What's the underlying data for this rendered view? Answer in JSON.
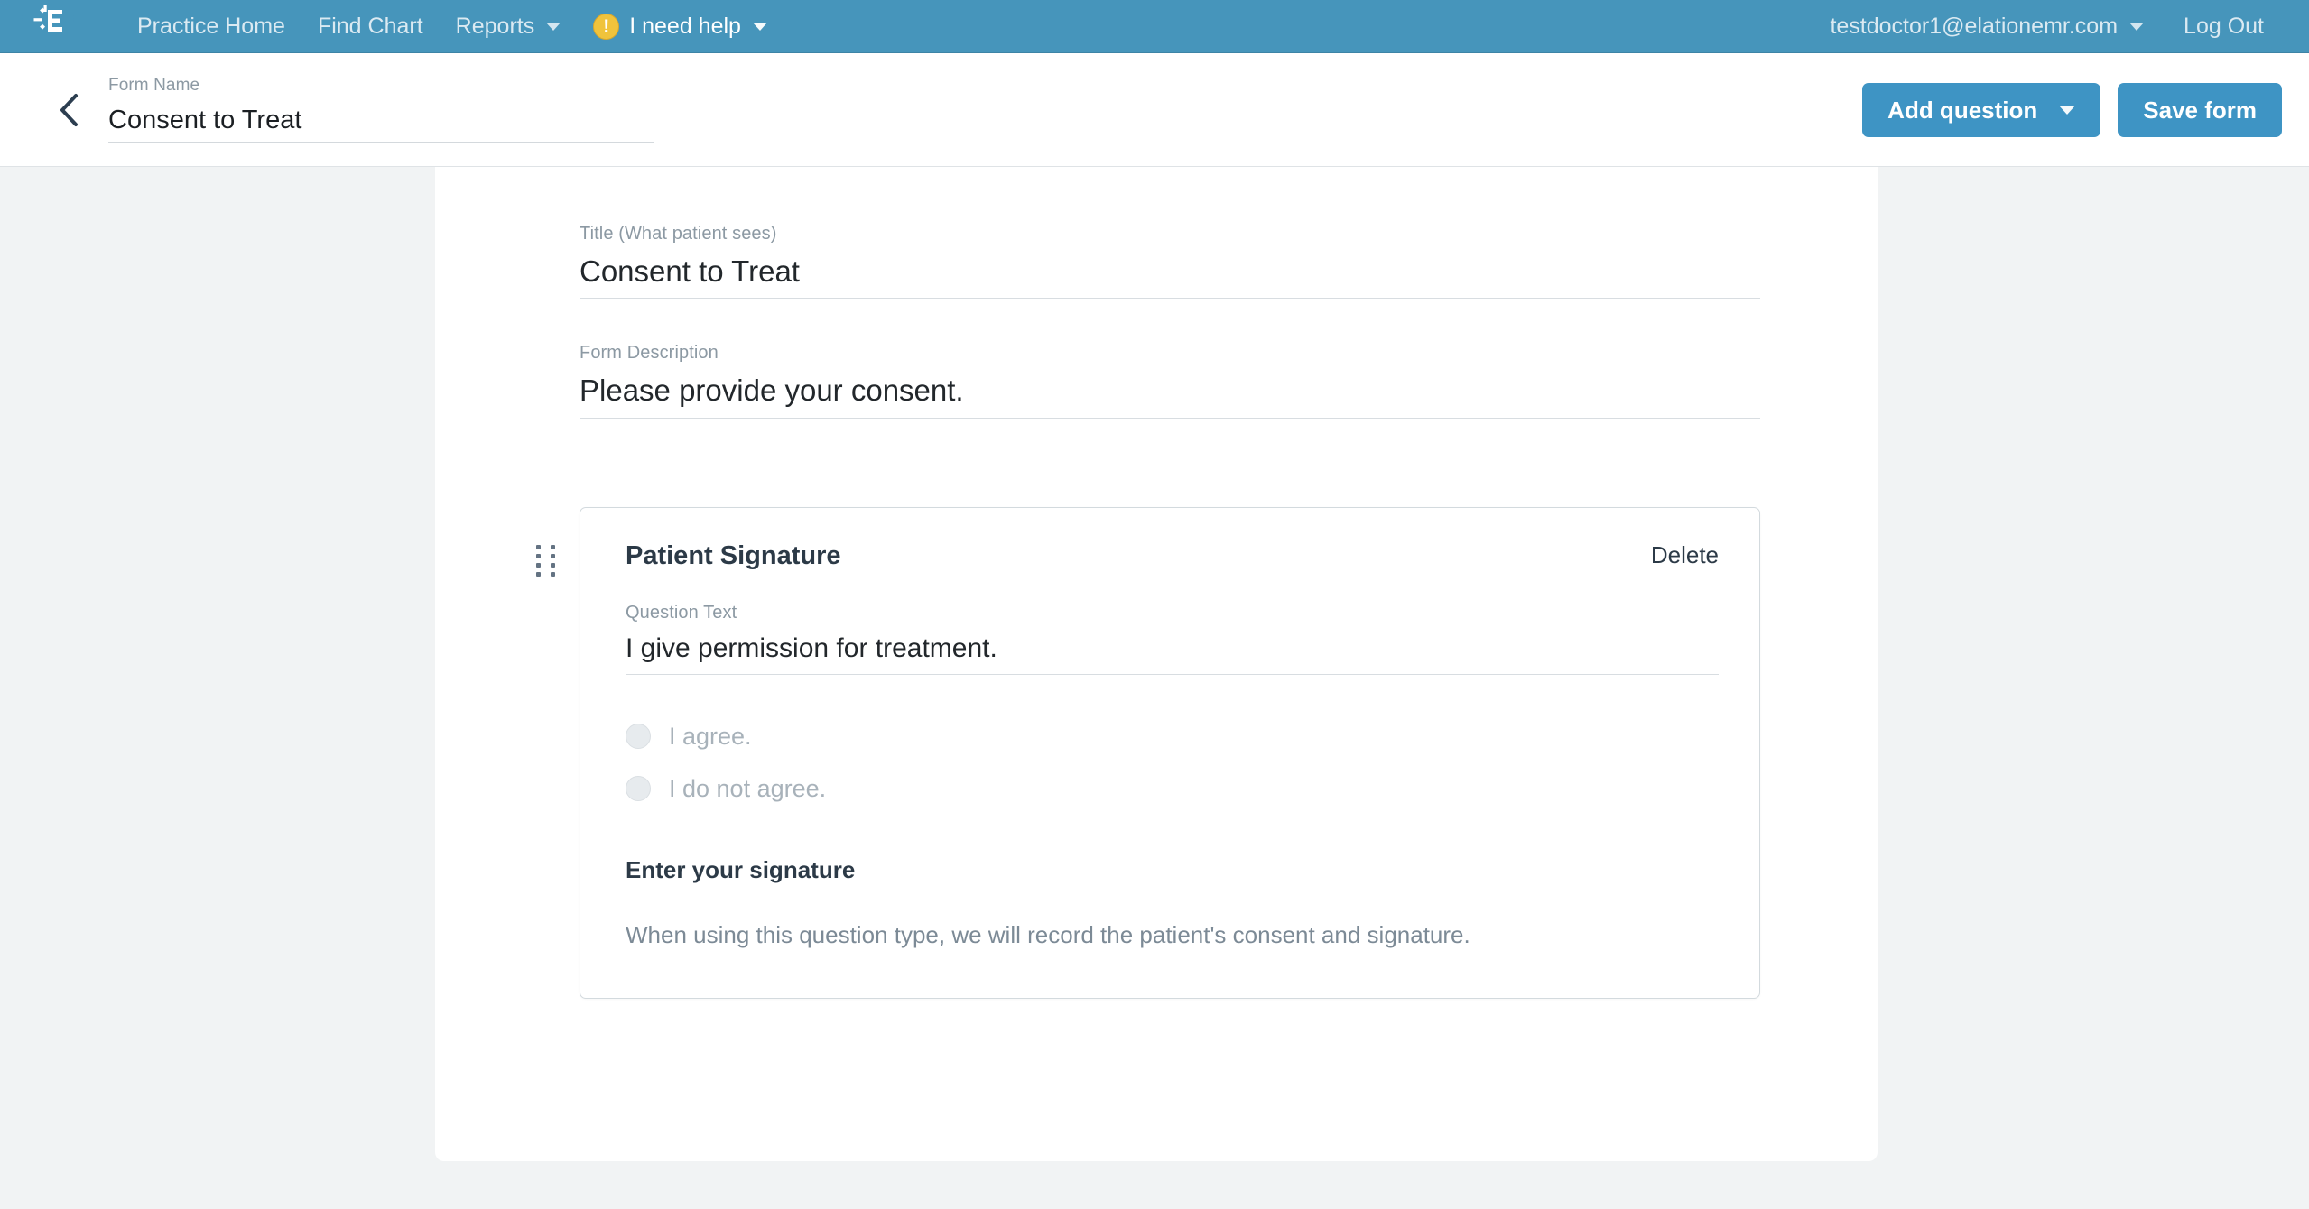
{
  "navbar": {
    "logo_icon": "elation-e-logo-icon",
    "items": [
      {
        "label": "Practice Home",
        "has_caret": false,
        "icon": null,
        "bright": false
      },
      {
        "label": "Find Chart",
        "has_caret": false,
        "icon": null,
        "bright": false
      },
      {
        "label": "Reports",
        "has_caret": true,
        "icon": null,
        "bright": false
      },
      {
        "label": "I need help",
        "has_caret": true,
        "icon": "warning-exclamation-icon",
        "bright": true
      }
    ],
    "account": "testdoctor1@elationemr.com",
    "logout": "Log Out",
    "background_color": "#4695bb",
    "link_color": "#dbeaf2",
    "help_icon_color": "#f0c33c"
  },
  "subheader": {
    "back_icon": "back-chevron-icon",
    "form_name_label": "Form Name",
    "form_name_value": "Consent to Treat",
    "form_name_placeholder": "Form Name",
    "add_question_label": "Add question",
    "save_form_label": "Save form",
    "button_color": "#3e94c4"
  },
  "form": {
    "title_label": "Title (What patient sees)",
    "title_value": "Consent to Treat",
    "title_placeholder": "Title (What patient sees)",
    "description_label": "Form Description",
    "description_value": "Please provide your consent.",
    "description_placeholder": "Form Description"
  },
  "question": {
    "drag_handle_icon": "drag-handle-icon",
    "type_title": "Patient Signature",
    "delete_label": "Delete",
    "question_text_label": "Question Text",
    "question_text_value": "I give permission for treatment.",
    "question_text_placeholder": "Question Text",
    "options": [
      {
        "label": "I agree.",
        "selected": false
      },
      {
        "label": "I do not agree.",
        "selected": false
      }
    ],
    "signature_heading": "Enter your signature",
    "signature_note": "When using this question type, we will record the patient's consent and signature."
  }
}
